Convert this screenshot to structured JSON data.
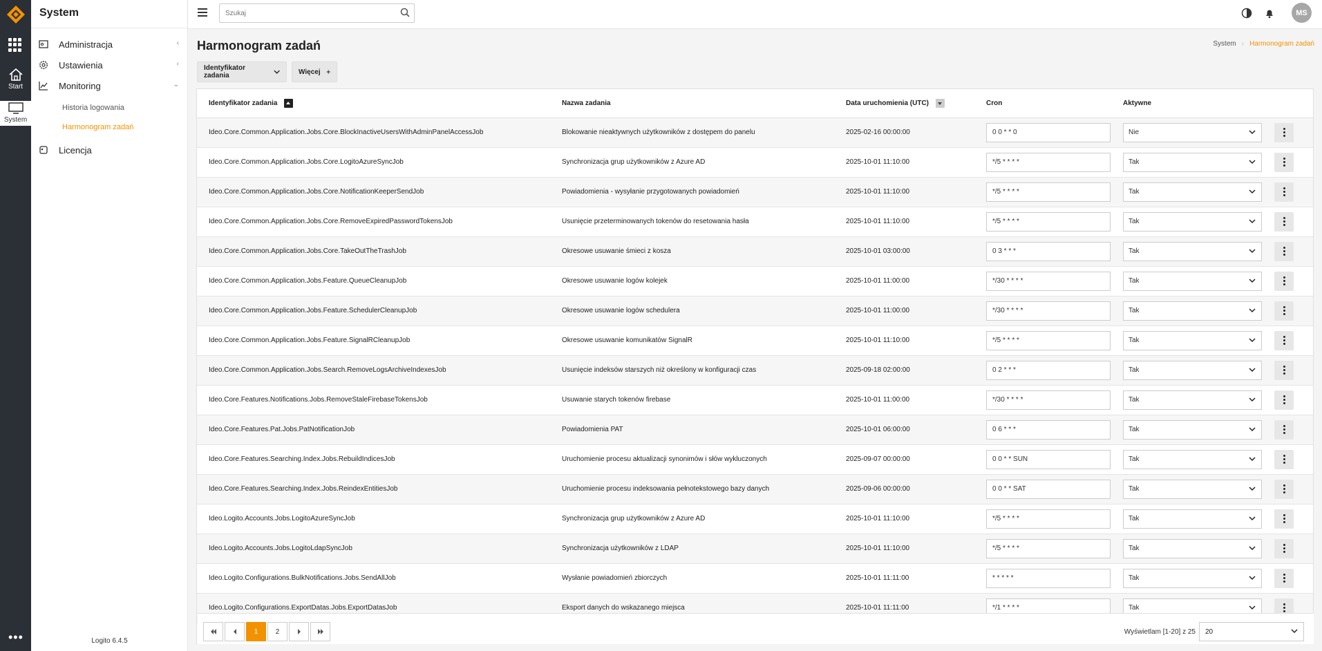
{
  "colors": {
    "accent": "#f39200",
    "rail": "#2b2f36"
  },
  "rail": {
    "start_label": "Start",
    "system_label": "System"
  },
  "sidebar": {
    "title": "System",
    "items": [
      {
        "label": "Administracja",
        "icon": "building-icon"
      },
      {
        "label": "Ustawienia",
        "icon": "gear-icon"
      },
      {
        "label": "Monitoring",
        "icon": "chart-icon"
      },
      {
        "label": "Licencja",
        "icon": "license-icon"
      }
    ],
    "sub_items": [
      "Historia logowania",
      "Harmonogram zadań"
    ],
    "version": "Logito 6.4.5"
  },
  "topbar": {
    "search_placeholder": "Szukaj",
    "avatar_initials": "MS"
  },
  "page": {
    "title": "Harmonogram zadań",
    "breadcrumb": [
      "System",
      "Harmonogram zadań"
    ],
    "filter_label": "Identyfikator zadania",
    "more_label": "Więcej"
  },
  "table": {
    "columns": [
      "Identyfikator zadania",
      "Nazwa zadania",
      "Data uruchomienia (UTC)",
      "Cron",
      "Aktywne"
    ],
    "rows": [
      {
        "id": "Ideo.Core.Common.Application.Jobs.Core.BlockInactiveUsersWithAdminPanelAccessJob",
        "name": "Blokowanie nieaktywnych użytkowników z dostępem do panelu",
        "date": "2025-02-16 00:00:00",
        "cron": "0 0 * * 0",
        "active": "Nie"
      },
      {
        "id": "Ideo.Core.Common.Application.Jobs.Core.LogitoAzureSyncJob",
        "name": "Synchronizacja grup użytkowników z Azure AD",
        "date": "2025-10-01 11:10:00",
        "cron": "*/5 * * * *",
        "active": "Tak"
      },
      {
        "id": "Ideo.Core.Common.Application.Jobs.Core.NotificationKeeperSendJob",
        "name": "Powiadomienia - wysyłanie przygotowanych powiadomień",
        "date": "2025-10-01 11:10:00",
        "cron": "*/5 * * * *",
        "active": "Tak"
      },
      {
        "id": "Ideo.Core.Common.Application.Jobs.Core.RemoveExpiredPasswordTokensJob",
        "name": "Usunięcie przeterminowanych tokenów do resetowania hasła",
        "date": "2025-10-01 11:10:00",
        "cron": "*/5 * * * *",
        "active": "Tak"
      },
      {
        "id": "Ideo.Core.Common.Application.Jobs.Core.TakeOutTheTrashJob",
        "name": "Okresowe usuwanie śmieci z kosza",
        "date": "2025-10-01 03:00:00",
        "cron": "0 3 * * *",
        "active": "Tak"
      },
      {
        "id": "Ideo.Core.Common.Application.Jobs.Feature.QueueCleanupJob",
        "name": "Okresowe usuwanie logów kolejek",
        "date": "2025-10-01 11:00:00",
        "cron": "*/30 * * * *",
        "active": "Tak"
      },
      {
        "id": "Ideo.Core.Common.Application.Jobs.Feature.SchedulerCleanupJob",
        "name": "Okresowe usuwanie logów schedulera",
        "date": "2025-10-01 11:00:00",
        "cron": "*/30 * * * *",
        "active": "Tak"
      },
      {
        "id": "Ideo.Core.Common.Application.Jobs.Feature.SignalRCleanupJob",
        "name": "Okresowe usuwanie komunikatów SignalR",
        "date": "2025-10-01 11:10:00",
        "cron": "*/5 * * * *",
        "active": "Tak"
      },
      {
        "id": "Ideo.Core.Common.Application.Jobs.Search.RemoveLogsArchiveIndexesJob",
        "name": "Usunięcie indeksów starszych niż określony w konfiguracji czas",
        "date": "2025-09-18 02:00:00",
        "cron": "0 2 * * *",
        "active": "Tak"
      },
      {
        "id": "Ideo.Core.Features.Notifications.Jobs.RemoveStaleFirebaseTokensJob",
        "name": "Usuwanie starych tokenów firebase",
        "date": "2025-10-01 11:00:00",
        "cron": "*/30 * * * *",
        "active": "Tak"
      },
      {
        "id": "Ideo.Core.Features.Pat.Jobs.PatNotificationJob",
        "name": "Powiadomienia PAT",
        "date": "2025-10-01 06:00:00",
        "cron": "0 6 * * *",
        "active": "Tak"
      },
      {
        "id": "Ideo.Core.Features.Searching.Index.Jobs.RebuildIndicesJob",
        "name": "Uruchomienie procesu aktualizacji synonimów i słów wykluczonych",
        "date": "2025-09-07 00:00:00",
        "cron": "0 0 * * SUN",
        "active": "Tak"
      },
      {
        "id": "Ideo.Core.Features.Searching.Index.Jobs.ReindexEntitiesJob",
        "name": "Uruchomienie procesu indeksowania pełnotekstowego bazy danych",
        "date": "2025-09-06 00:00:00",
        "cron": "0 0 * * SAT",
        "active": "Tak"
      },
      {
        "id": "Ideo.Logito.Accounts.Jobs.LogitoAzureSyncJob",
        "name": "Synchronizacja grup użytkowników z Azure AD",
        "date": "2025-10-01 11:10:00",
        "cron": "*/5 * * * *",
        "active": "Tak"
      },
      {
        "id": "Ideo.Logito.Accounts.Jobs.LogitoLdapSyncJob",
        "name": "Synchronizacja użytkowników z LDAP",
        "date": "2025-10-01 11:10:00",
        "cron": "*/5 * * * *",
        "active": "Tak"
      },
      {
        "id": "Ideo.Logito.Configurations.BulkNotifications.Jobs.SendAllJob",
        "name": "Wysłanie powiadomień zbiorczych",
        "date": "2025-10-01 11:11:00",
        "cron": "* * * * *",
        "active": "Tak"
      },
      {
        "id": "Ideo.Logito.Configurations.ExportDatas.Jobs.ExportDatasJob",
        "name": "Eksport danych do wskazanego miejsca",
        "date": "2025-10-01 11:11:00",
        "cron": "*/1 * * * *",
        "active": "Tak"
      }
    ]
  },
  "pagination": {
    "pages": [
      "1",
      "2"
    ],
    "current_page": "1",
    "info": "Wyświetlam [1-20] z 25",
    "page_size": "20"
  }
}
